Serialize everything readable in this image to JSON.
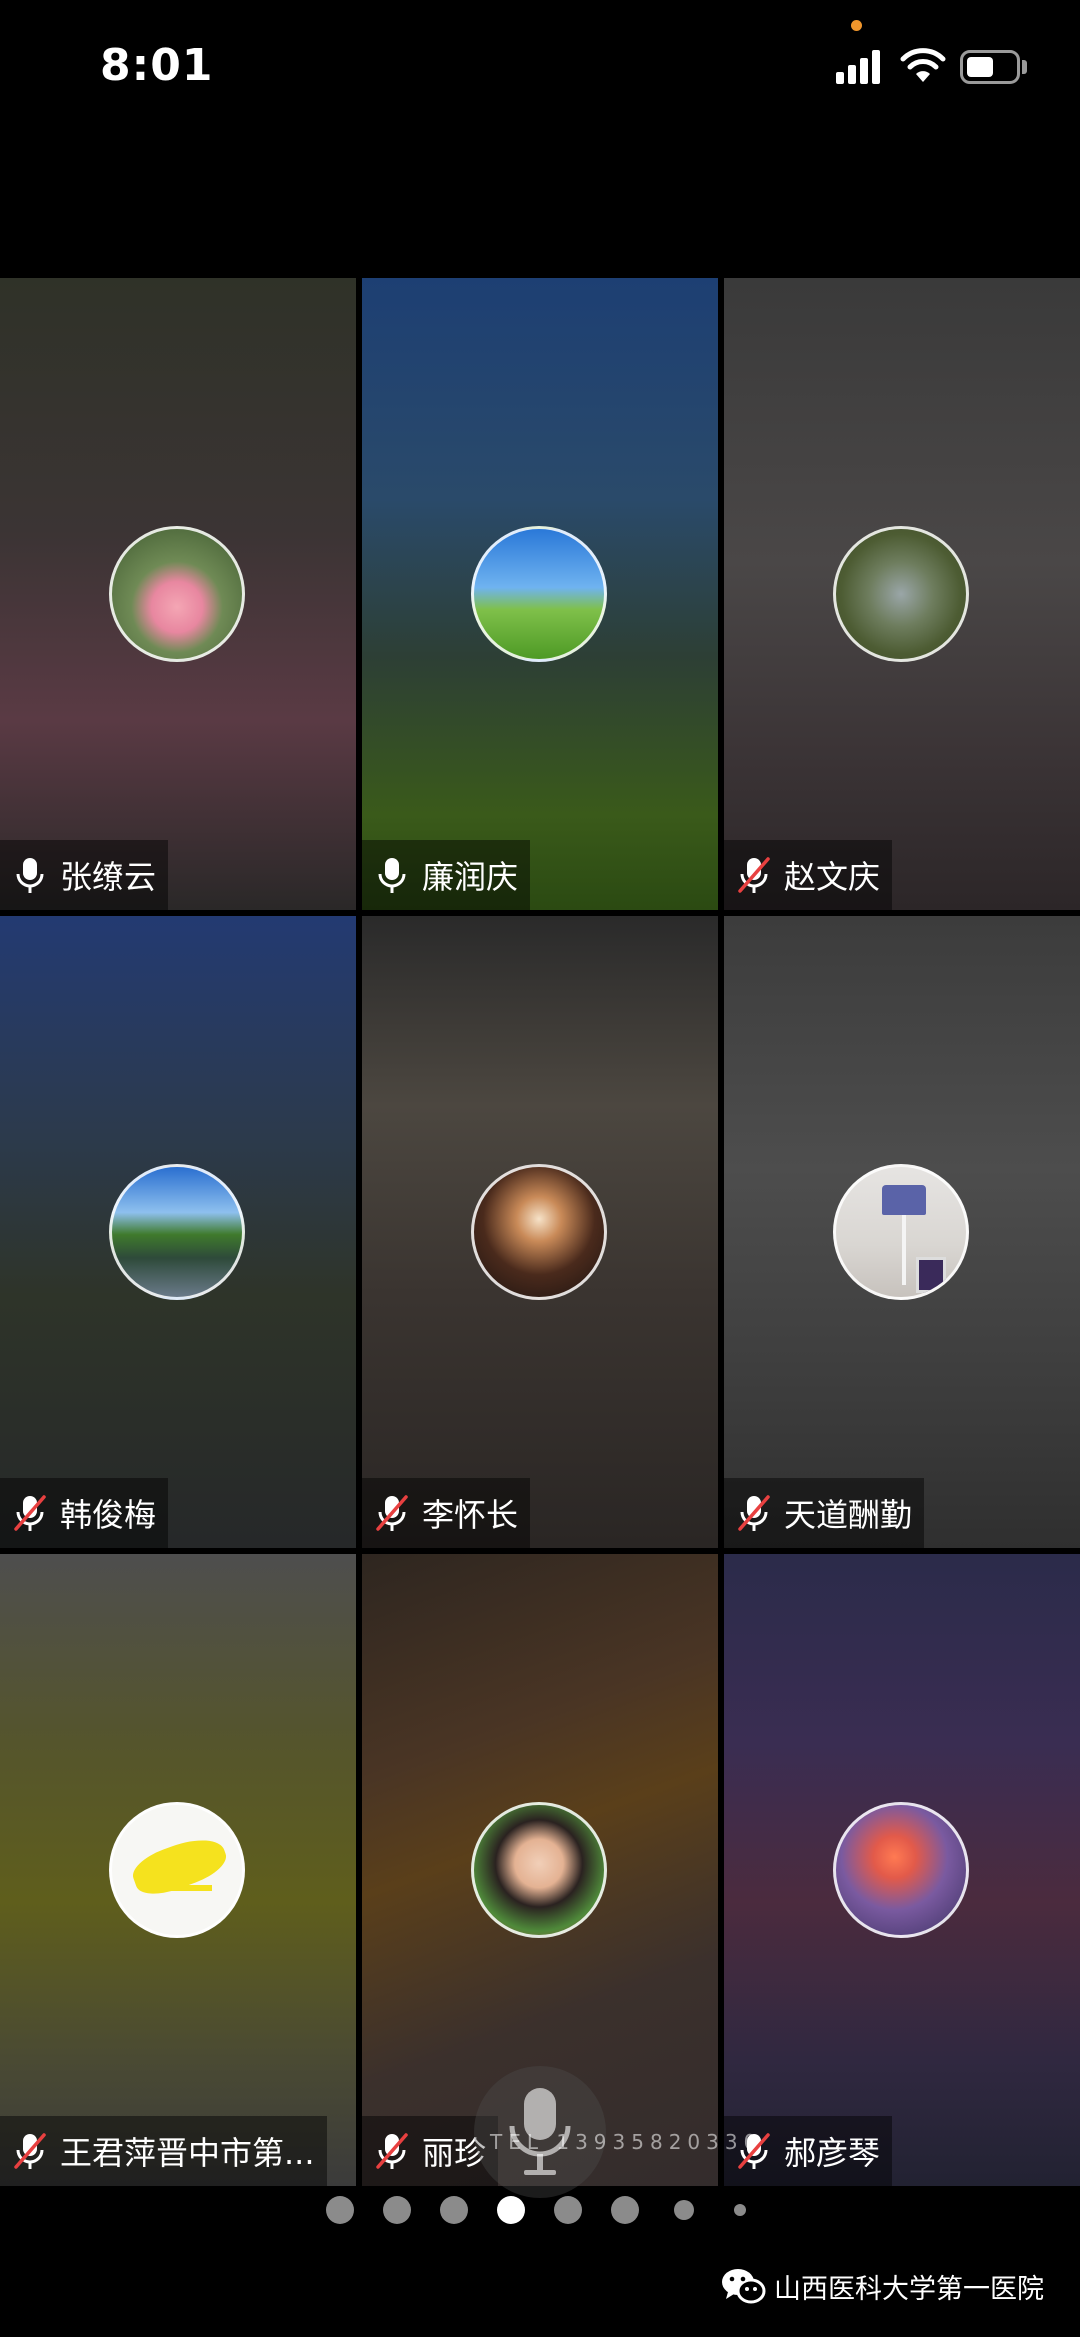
{
  "status_bar": {
    "time": "8:01",
    "recording_dot_color": "#f0962c",
    "icons": [
      "signal-icon",
      "wifi-icon",
      "battery-icon"
    ]
  },
  "participants": [
    {
      "name": "张缭云",
      "mic": "on",
      "avatar": "rose"
    },
    {
      "name": "廉润庆",
      "mic": "on",
      "avatar": "tree-on-hill"
    },
    {
      "name": "赵文庆",
      "mic": "muted",
      "avatar": "canyon"
    },
    {
      "name": "韩俊梅",
      "mic": "muted",
      "avatar": "lake"
    },
    {
      "name": "李怀长",
      "mic": "muted",
      "avatar": "fireworks"
    },
    {
      "name": "天道酬勤",
      "mic": "muted",
      "avatar": "lamp"
    },
    {
      "name": "王君萍晋中市第...",
      "mic": "muted",
      "avatar": "giraffe-drawing"
    },
    {
      "name": "丽珍",
      "mic": "muted",
      "avatar": "girl"
    },
    {
      "name": "郝彦琴",
      "mic": "muted",
      "avatar": "tulips"
    }
  ],
  "pager": {
    "total": 8,
    "active_index": 3
  },
  "floating_mic": {
    "text": "TEL 13935820330"
  },
  "footer": {
    "text": "山西医科大学第一医院",
    "icon": "wechat-icon"
  }
}
